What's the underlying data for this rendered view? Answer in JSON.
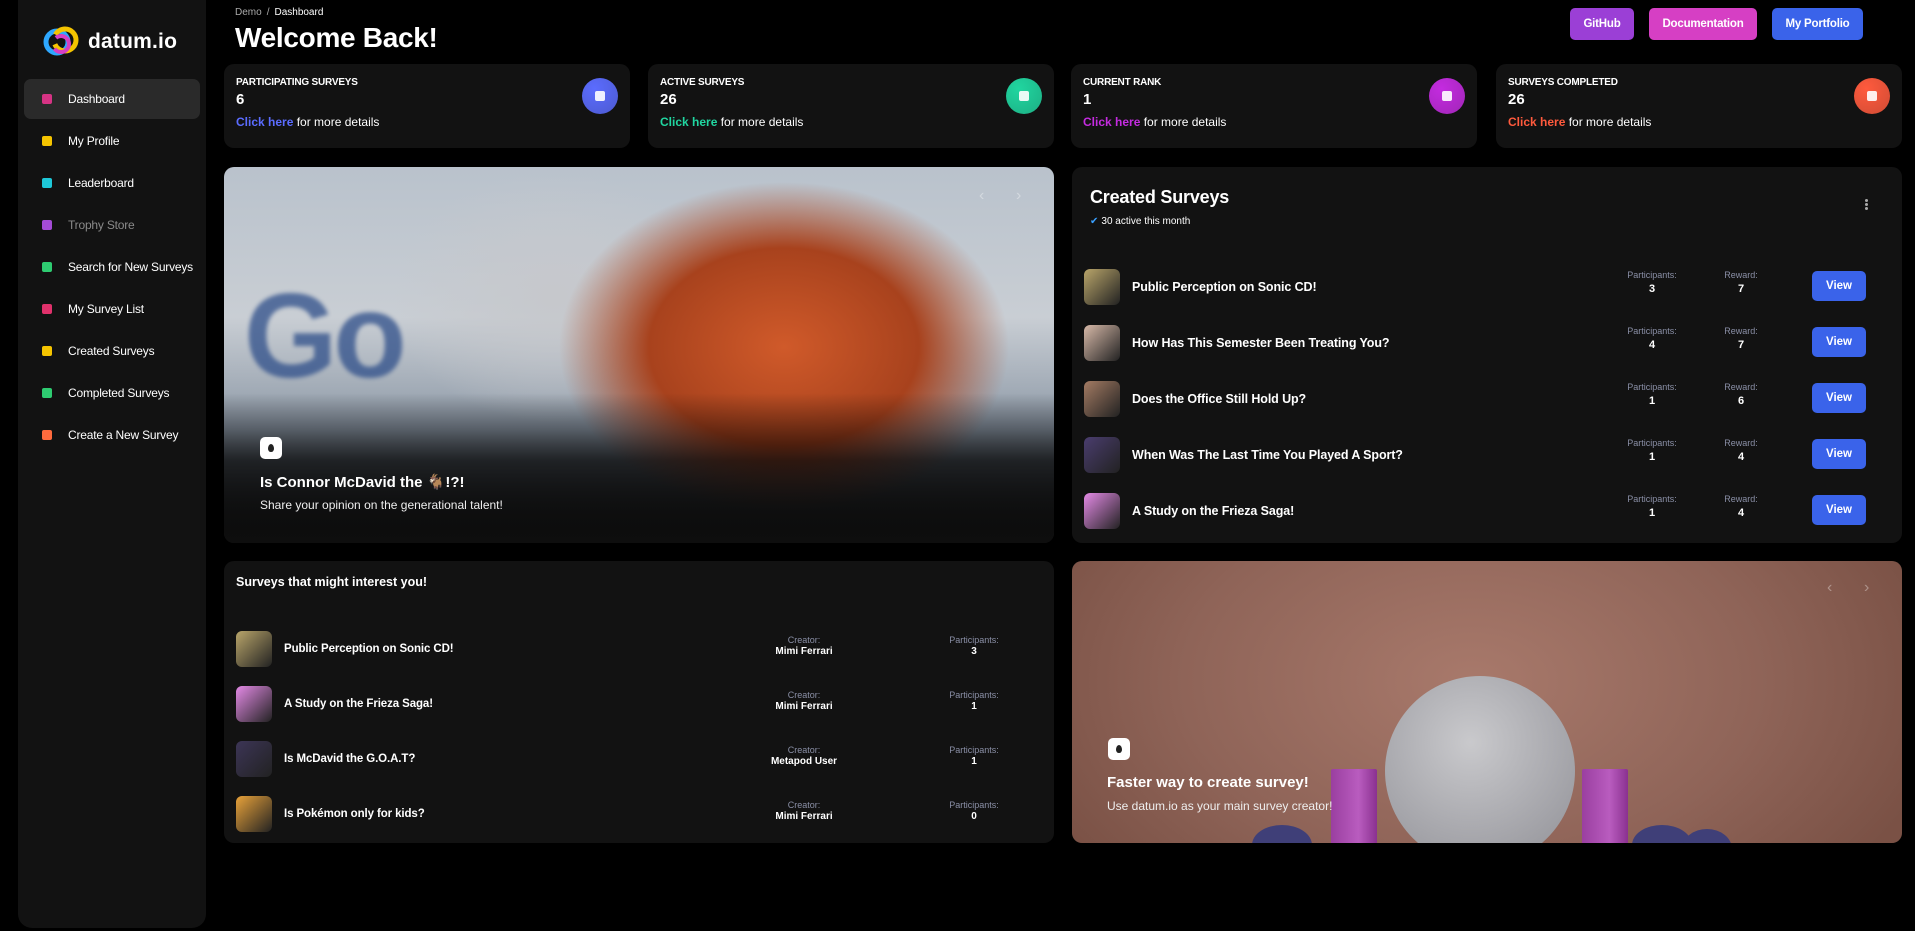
{
  "app": {
    "name": "datum.io"
  },
  "sidebar": {
    "items": [
      {
        "label": "Dashboard",
        "color": "#d63384",
        "active": true
      },
      {
        "label": "My Profile",
        "color": "#f5c400"
      },
      {
        "label": "Leaderboard",
        "color": "#1ec8d8"
      },
      {
        "label": "Trophy Store",
        "color": "#a44bd6",
        "disabled": true
      },
      {
        "label": "Search for New Surveys",
        "color": "#2ecc71"
      },
      {
        "label": "My Survey List",
        "color": "#e0316b"
      },
      {
        "label": "Created Surveys",
        "color": "#f5c400"
      },
      {
        "label": "Completed Surveys",
        "color": "#2ecc71"
      },
      {
        "label": "Create a New Survey",
        "color": "#ff6a3d"
      }
    ]
  },
  "header": {
    "breadcrumb": [
      "Demo",
      "Dashboard"
    ],
    "title": "Welcome Back!",
    "buttons": [
      {
        "label": "GitHub",
        "color": "#9b3fd6"
      },
      {
        "label": "Documentation",
        "color": "#d63fc4"
      },
      {
        "label": "My Portfolio",
        "color": "#3a63ea"
      }
    ]
  },
  "stats": [
    {
      "label": "PARTICIPATING SURVEYS",
      "value": "6",
      "link": "Click here",
      "rest": " for more details",
      "accent": "#5b6cff"
    },
    {
      "label": "ACTIVE SURVEYS",
      "value": "26",
      "link": "Click here",
      "rest": " for more details",
      "accent": "#20d6a0"
    },
    {
      "label": "CURRENT RANK",
      "value": "1",
      "link": "Click here",
      "rest": " for more details",
      "accent": "#c42be0"
    },
    {
      "label": "SURVEYS COMPLETED",
      "value": "26",
      "link": "Click here",
      "rest": " for more details",
      "accent": "#ff5a3d"
    }
  ],
  "hero": {
    "title": "Is Connor McDavid the 🐐!?!",
    "subtitle": "Share your opinion on the generational talent!"
  },
  "created_surveys": {
    "title": "Created Surveys",
    "subtitle": "30 active this month",
    "participants_label": "Participants:",
    "reward_label": "Reward:",
    "view_label": "View",
    "rows": [
      {
        "title": "Public Perception on Sonic CD!",
        "participants": "3",
        "reward": "7",
        "thumb": "#b9a56a"
      },
      {
        "title": "How Has This Semester Been Treating You?",
        "participants": "4",
        "reward": "7",
        "thumb": "#d7b9a8"
      },
      {
        "title": "Does the Office Still Hold Up?",
        "participants": "1",
        "reward": "6",
        "thumb": "#a47b63"
      },
      {
        "title": "When Was The Last Time You Played A Sport?",
        "participants": "1",
        "reward": "4",
        "thumb": "#4a3d6e"
      },
      {
        "title": "A Study on the Frieza Saga!",
        "participants": "1",
        "reward": "4",
        "thumb": "#e48ae6"
      }
    ]
  },
  "interest": {
    "title": "Surveys that might interest you!",
    "creator_label": "Creator:",
    "participants_label": "Participants:",
    "rows": [
      {
        "title": "Public Perception on Sonic CD!",
        "creator": "Mimi Ferrari",
        "participants": "3",
        "thumb": "#b9a56a"
      },
      {
        "title": "A Study on the Frieza Saga!",
        "creator": "Mimi Ferrari",
        "participants": "1",
        "thumb": "#e48ae6"
      },
      {
        "title": "Is McDavid the G.O.A.T?",
        "creator": "Metapod User",
        "participants": "1",
        "thumb": "#3c3556"
      },
      {
        "title": "Is Pokémon only for kids?",
        "creator": "Mimi Ferrari",
        "participants": "0",
        "thumb": "#e8a23a"
      }
    ]
  },
  "promo": {
    "title": "Faster way to create survey!",
    "subtitle": "Use datum.io as your main survey creator!"
  }
}
